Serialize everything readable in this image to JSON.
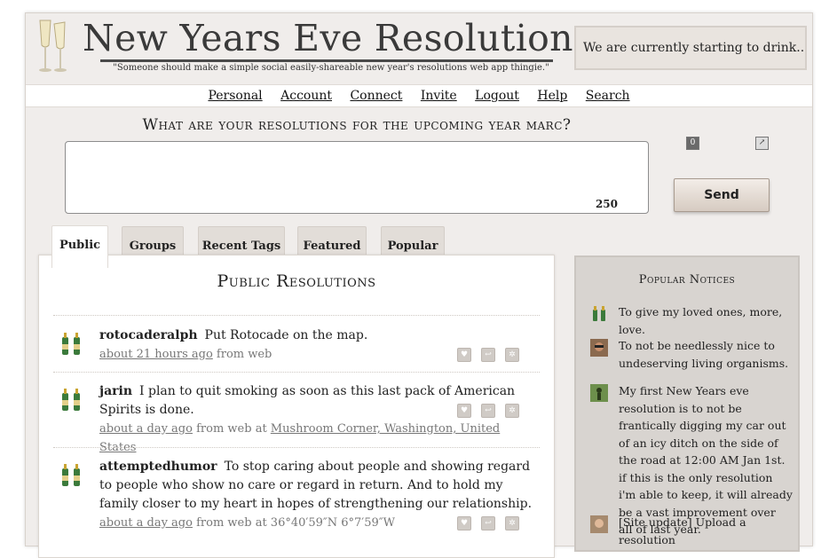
{
  "header": {
    "title": "New Years Eve Resolutions",
    "tagline": "\"Someone should make a simple social easily-shareable new year's resolutions web app thingie.\"",
    "status": "We are currently starting to drink..."
  },
  "nav": [
    "Personal",
    "Account",
    "Connect",
    "Invite",
    "Logout",
    "Help",
    "Search"
  ],
  "composer": {
    "question": "What are your resolutions for the upcoming year marc?",
    "char_count": "250",
    "send_label": "Send"
  },
  "tabs": [
    "Public",
    "Groups",
    "Recent Tags",
    "Featured",
    "Popular"
  ],
  "panel": {
    "title": "Public Resolutions",
    "items": [
      {
        "user": "rotocaderalph",
        "text": "Put Rotocade on the map.",
        "time": "about 21 hours ago",
        "source": " from web",
        "location": ""
      },
      {
        "user": "jarin",
        "text": "I plan to quit smoking as soon as this last pack of American Spirits is done.",
        "time": "about a day ago",
        "source": " from web at ",
        "location": "Mushroom Corner, Washington, United States"
      },
      {
        "user": "attemptedhumor",
        "text": "To stop caring about people and showing regard to people who show no care or regard in return. And to hold my family closer to my heart in hopes of strengthening our relationship.",
        "time": "about a day ago",
        "source": " from web at 36°40′59″N 6°7′59″W",
        "location": ""
      }
    ]
  },
  "sidebar": {
    "title": "Popular Notices",
    "notices": [
      "To give my loved ones, more, love.",
      "To not be needlessly nice to undeserving living organisms.",
      "My first New Years eve resolution is to not be frantically digging my car out of an icy ditch on the side of the road at 12:00 AM Jan 1st. if this is the only resolution i'm able to keep, it will already be a vast improvement over all of last year.",
      "[Site update] Upload a resolution"
    ]
  },
  "icons": {
    "avatar": "champagne-glasses-icon",
    "favorite": "heart-icon",
    "reply": "reply-icon",
    "repeat": "repeat-icon",
    "attach": "paperclip-icon",
    "location": "pin-icon"
  }
}
